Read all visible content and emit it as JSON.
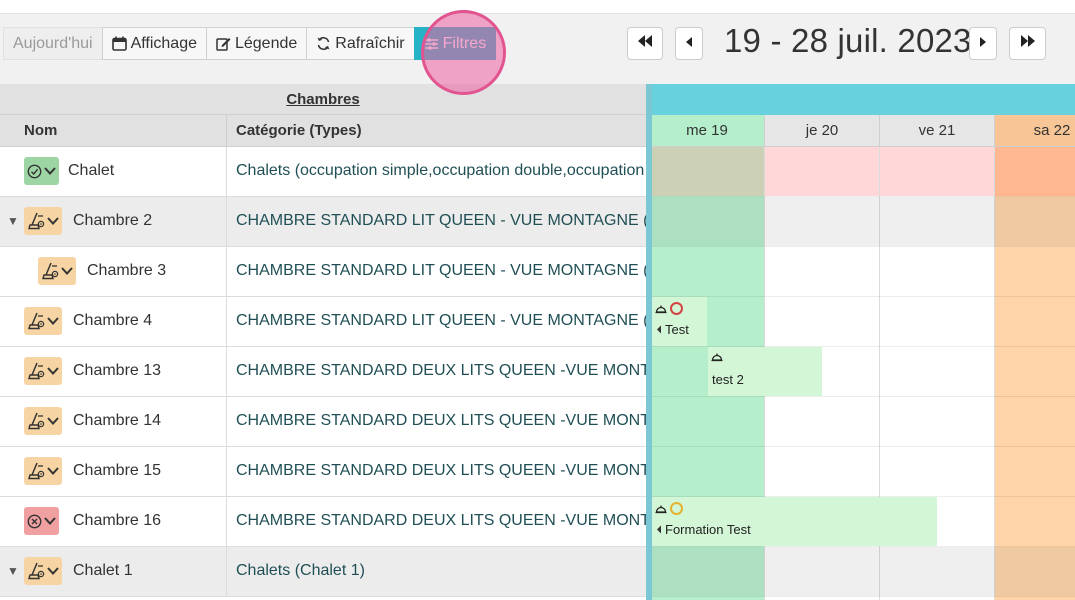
{
  "toolbar": {
    "today_label": "Aujourd'hui",
    "display_label": "Affichage",
    "legend_label": "Légende",
    "refresh_label": "Rafraîchir",
    "filters_label": "Filtres",
    "date_range": "19 - 28 juil. 2023"
  },
  "grid": {
    "group_header": "Chambres",
    "col_name": "Nom",
    "col_category": "Catégorie (Types)"
  },
  "rows": [
    {
      "name": "Chalet",
      "category": "Chalets (occupation simple,occupation double,occupation tri",
      "status": "ok",
      "group": false
    },
    {
      "name": "Chambre 2",
      "category": "CHAMBRE STANDARD LIT QUEEN - VUE MONTAGNE (SIMPLE)",
      "status": "dirty",
      "group": true
    },
    {
      "name": "Chambre 3",
      "category": "CHAMBRE STANDARD LIT QUEEN - VUE MONTAGNE (SIMPLE)",
      "status": "dirty",
      "group": false
    },
    {
      "name": "Chambre 4",
      "category": "CHAMBRE STANDARD LIT QUEEN - VUE MONTAGNE (SIMPLE)",
      "status": "dirty",
      "group": false
    },
    {
      "name": "Chambre 13",
      "category": "CHAMBRE STANDARD DEUX LITS QUEEN -VUE MONTAGNE",
      "status": "dirty",
      "group": false
    },
    {
      "name": "Chambre 14",
      "category": "CHAMBRE STANDARD DEUX LITS QUEEN -VUE MONTAGNE",
      "status": "dirty",
      "group": false
    },
    {
      "name": "Chambre 15",
      "category": "CHAMBRE STANDARD DEUX LITS QUEEN -VUE MONTAGNE",
      "status": "dirty",
      "group": false
    },
    {
      "name": "Chambre 16",
      "category": "CHAMBRE STANDARD DEUX LITS QUEEN -VUE MONTAGNE",
      "status": "blocked",
      "group": false
    },
    {
      "name": "Chalet 1",
      "category": "Chalets (Chalet 1)",
      "status": "dirty",
      "group": true
    }
  ],
  "calendar": {
    "days": [
      {
        "label": "me 19",
        "color": "#b4eecb",
        "header_color": "#b4eecb"
      },
      {
        "label": "je 20",
        "color": "#ffffff",
        "header_color": "#e6e6e6"
      },
      {
        "label": "ve 21",
        "color": "#ffffff",
        "header_color": "#e6e6e6"
      },
      {
        "label": "sa 22",
        "color": "#ffd4a8",
        "header_color": "#f7c596"
      }
    ],
    "bookings": [
      {
        "label": "Test",
        "row": 3,
        "status_color": "red"
      },
      {
        "label": "test 2",
        "row": 4
      },
      {
        "label": "Formation Test",
        "row": 7,
        "status_color": "yellow"
      }
    ]
  },
  "colors": {
    "accent": "#26b3c6",
    "status_ok": "#9dd6a4",
    "status_dirty": "#f7d4a3",
    "status_blocked": "#f0a0a0",
    "booking": "#d3f7d6"
  }
}
